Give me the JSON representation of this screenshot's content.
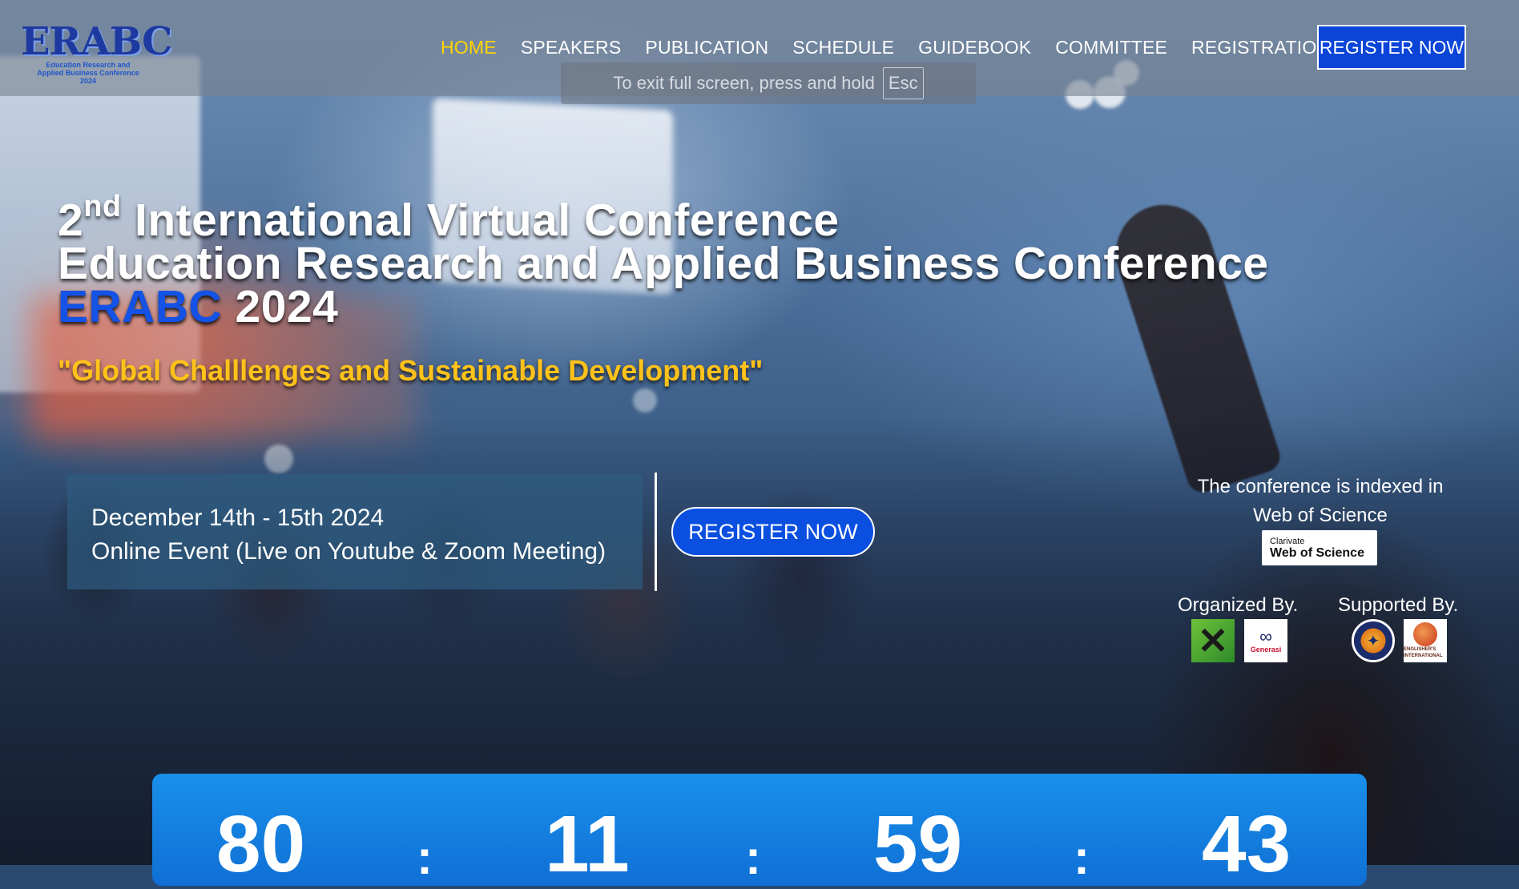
{
  "header": {
    "logo": {
      "main": "ERABC",
      "sub": "Education Research and Applied Business Conference 2024"
    },
    "nav": [
      "HOME",
      "SPEAKERS",
      "PUBLICATION",
      "SCHEDULE",
      "GUIDEBOOK",
      "COMMITTEE",
      "REGISTRATION"
    ],
    "active_nav": "HOME",
    "register_button": "REGISTER NOW"
  },
  "fullscreen_notice": {
    "text": "To exit full screen, press and hold",
    "key": "Esc"
  },
  "hero": {
    "title_line1_ordinal_num": "2",
    "title_line1_ordinal_suffix": "nd",
    "title_line1_rest": "International Virtual Conference",
    "title_line2": "Education Research and Applied Business Conference",
    "title_line3_accent": "ERABC",
    "title_line3_year": "2024",
    "tagline": "\"Global Challlenges and Sustainable Development\"",
    "date": "December 14th - 15th 2024",
    "venue": "Online Event (Live on Youtube & Zoom Meeting)",
    "register_button": "REGISTER NOW"
  },
  "indexing": {
    "text_line1": "The conference is indexed in",
    "text_line2": "Web of Science",
    "badge_small": "Clarivate",
    "badge_big": "Web of Science"
  },
  "organizers": {
    "organized_label": "Organized By.",
    "supported_label": "Supported By.",
    "organizer_logos": [
      "x-logo",
      "generasi-logo"
    ],
    "generasi_text": "Generasi",
    "supporter_logos": [
      "seal-logo",
      "englisher-logo"
    ],
    "englisher_text": "ENGLISHER'S INTERNATIONAL"
  },
  "countdown": {
    "values": [
      "80",
      "11",
      "59",
      "43"
    ],
    "separator": ":"
  },
  "colors": {
    "accent_blue": "#1552e6",
    "active_nav": "#ffd400",
    "tagline": "#ffc21a",
    "button": "#0a45d8"
  }
}
